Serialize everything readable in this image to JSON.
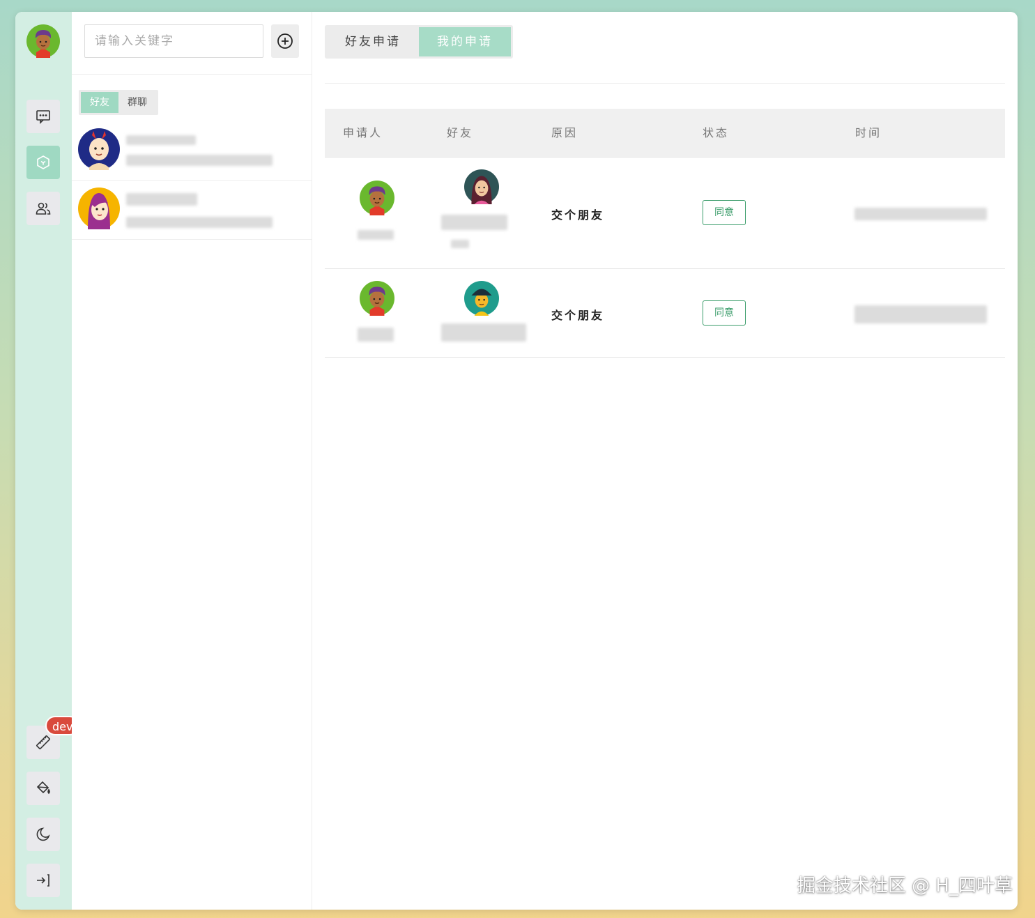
{
  "sidebar": {
    "dev_badge": "dev"
  },
  "contacts": {
    "search_placeholder": "请输入关键字",
    "segments": [
      {
        "label": "好友",
        "active": true
      },
      {
        "label": "群聊",
        "active": false
      }
    ]
  },
  "main": {
    "tabs": [
      {
        "label": "好友申请",
        "active": false
      },
      {
        "label": "我的申请",
        "active": true
      }
    ],
    "table": {
      "headers": [
        "申请人",
        "好友",
        "原因",
        "状态",
        "时间"
      ],
      "rows": [
        {
          "reason": "交个朋友",
          "status": "同意"
        },
        {
          "reason": "交个朋友",
          "status": "同意"
        }
      ]
    }
  },
  "watermark": "掘金技术社区 @ H_四叶草",
  "colors": {
    "accent": "#9fd9c2",
    "rail_bg": "#d3eee3",
    "agree": "#3a9c6a",
    "badge": "#d94a3d"
  }
}
